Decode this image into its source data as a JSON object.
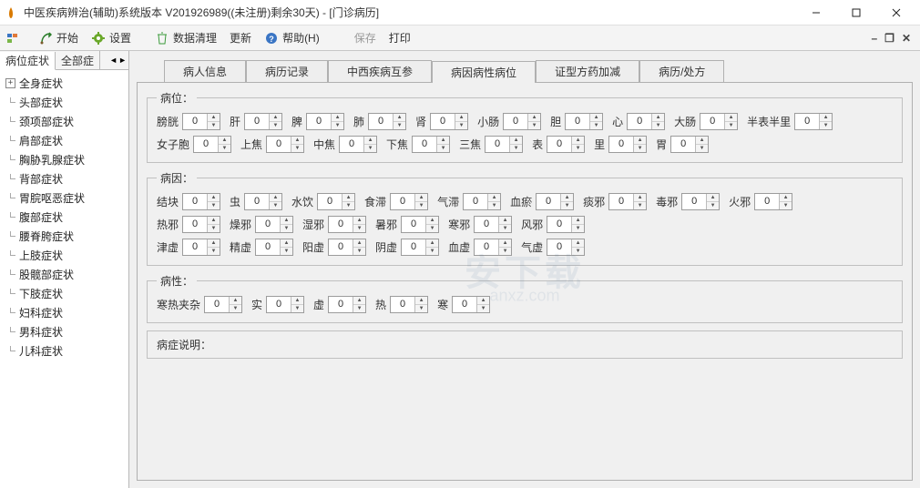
{
  "window": {
    "title": "中医疾病辨治(辅助)系统版本 V201926989((未注册)剩余30天) - [门诊病历]"
  },
  "toolbar": {
    "start": "开始",
    "settings": "设置",
    "clean": "数据清理",
    "refresh": "更新",
    "help": "帮助(H)",
    "save": "保存",
    "print": "打印"
  },
  "sidebar": {
    "tab1": "病位症状",
    "tab2": "全部症",
    "nodes": [
      {
        "label": "全身症状",
        "exp": true
      },
      {
        "label": "头部症状"
      },
      {
        "label": "颈项部症状"
      },
      {
        "label": "肩部症状"
      },
      {
        "label": "胸胁乳腺症状"
      },
      {
        "label": "背部症状"
      },
      {
        "label": "胃脘呕恶症状"
      },
      {
        "label": "腹部症状"
      },
      {
        "label": "腰脊胯症状"
      },
      {
        "label": "上肢症状"
      },
      {
        "label": "股髋部症状"
      },
      {
        "label": "下肢症状"
      },
      {
        "label": "妇科症状"
      },
      {
        "label": "男科症状"
      },
      {
        "label": "儿科症状"
      }
    ]
  },
  "tabs": [
    "病人信息",
    "病历记录",
    "中西疾病互参",
    "病因病性病位",
    "证型方药加减",
    "病历/处方"
  ],
  "active_tab": 3,
  "groups": {
    "g1": {
      "legend": "病位：",
      "rows": [
        [
          {
            "l": "膀胱",
            "v": "0"
          },
          {
            "l": "肝",
            "v": "0"
          },
          {
            "l": "脾",
            "v": "0"
          },
          {
            "l": "肺",
            "v": "0"
          },
          {
            "l": "肾",
            "v": "0"
          },
          {
            "l": "小肠",
            "v": "0"
          },
          {
            "l": "胆",
            "v": "0"
          },
          {
            "l": "心",
            "v": "0"
          },
          {
            "l": "大肠",
            "v": "0"
          },
          {
            "l": "半表半里",
            "v": "0"
          }
        ],
        [
          {
            "l": "女子胞",
            "v": "0"
          },
          {
            "l": "上焦",
            "v": "0"
          },
          {
            "l": "中焦",
            "v": "0"
          },
          {
            "l": "下焦",
            "v": "0"
          },
          {
            "l": "三焦",
            "v": "0"
          },
          {
            "l": "表",
            "v": "0"
          },
          {
            "l": "里",
            "v": "0"
          },
          {
            "l": "胃",
            "v": "0"
          }
        ]
      ]
    },
    "g2": {
      "legend": "病因：",
      "rows": [
        [
          {
            "l": "结块",
            "v": "0"
          },
          {
            "l": "虫",
            "v": "0"
          },
          {
            "l": "水饮",
            "v": "0"
          },
          {
            "l": "食滞",
            "v": "0"
          },
          {
            "l": "气滞",
            "v": "0"
          },
          {
            "l": "血瘀",
            "v": "0"
          },
          {
            "l": "痰邪",
            "v": "0"
          },
          {
            "l": "毒邪",
            "v": "0"
          },
          {
            "l": "火邪",
            "v": "0"
          }
        ],
        [
          {
            "l": "热邪",
            "v": "0"
          },
          {
            "l": "燥邪",
            "v": "0"
          },
          {
            "l": "湿邪",
            "v": "0"
          },
          {
            "l": "暑邪",
            "v": "0"
          },
          {
            "l": "寒邪",
            "v": "0"
          },
          {
            "l": "风邪",
            "v": "0"
          }
        ],
        [
          {
            "l": "津虚",
            "v": "0"
          },
          {
            "l": "精虚",
            "v": "0"
          },
          {
            "l": "阳虚",
            "v": "0"
          },
          {
            "l": "阴虚",
            "v": "0"
          },
          {
            "l": "血虚",
            "v": "0"
          },
          {
            "l": "气虚",
            "v": "0"
          }
        ]
      ]
    },
    "g3": {
      "legend": "病性：",
      "rows": [
        [
          {
            "l": "寒热夹杂",
            "v": "0"
          },
          {
            "l": "实",
            "v": "0"
          },
          {
            "l": "虚",
            "v": "0"
          },
          {
            "l": "热",
            "v": "0"
          },
          {
            "l": "寒",
            "v": "0"
          }
        ]
      ]
    },
    "desc_label": "病症说明："
  },
  "watermark": {
    "main": "安下载",
    "sub": "anxz.com"
  }
}
